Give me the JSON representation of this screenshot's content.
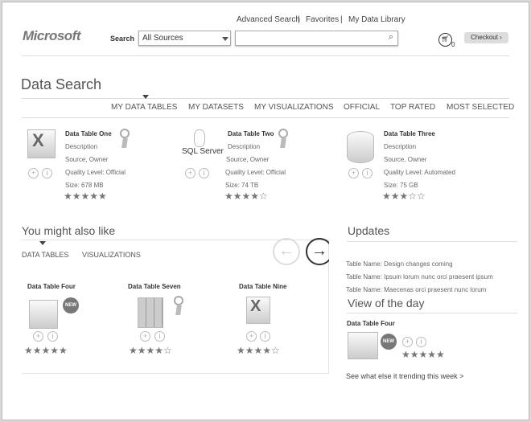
{
  "header": {
    "links": [
      "Advanced Search",
      "Favorites",
      "My Data Library"
    ],
    "separator": "|",
    "logo": "Microsoft",
    "search_label": "Search",
    "source_select": "All Sources",
    "search_value": "",
    "cart_count": "0",
    "checkout": "Checkout ›"
  },
  "main": {
    "title": "Data Search",
    "tabs": [
      "MY DATA TABLES",
      "MY DATASETS",
      "MY VISUALIZATIONS",
      "OFFICIAL",
      "TOP RATED",
      "MOST SELECTED"
    ],
    "active_tab": 0,
    "cards": [
      {
        "title": "Data Table One",
        "description": "Description",
        "source": "Source, Owner",
        "quality": "Quality Level: Official",
        "size": "Size: 678 MB",
        "stars": "★★★★★",
        "rating": 5,
        "icon": "excel-icon",
        "award": true
      },
      {
        "title": "Data Table Two",
        "description": "Description",
        "source": "Source, Owner",
        "quality": "Quality Level: Official",
        "size": "Size: 74 TB",
        "stars": "★★★★☆",
        "rating": 4,
        "icon": "sql-server-icon",
        "icon_text": "SQL Server",
        "award": true
      },
      {
        "title": "Data Table Three",
        "description": "Description",
        "source": "Source, Owner",
        "quality": "Quality Level: Automated",
        "size": "Size: 75 GB",
        "stars": "★★★☆☆",
        "rating": 3,
        "icon": "database-icon",
        "award": false
      }
    ]
  },
  "suggest": {
    "title": "You might also like",
    "tabs": [
      "DATA TABLES",
      "VISUALIZATIONS"
    ],
    "items": [
      {
        "title": "Data Table Four",
        "stars": "★★★★★",
        "rating": 5,
        "badge": "NEW"
      },
      {
        "title": "Data Table Seven",
        "stars": "★★★★☆",
        "rating": 4
      },
      {
        "title": "Data Table Nine",
        "stars": "★★★★☆",
        "rating": 4
      }
    ]
  },
  "updates": {
    "title": "Updates",
    "items": [
      "Table Name: Design changes coming",
      "Table Name: Ipsum lorum nunc orci praesent ipsum",
      "Table Name: Maecenas orci praesent nunc lorum"
    ]
  },
  "view_of_day": {
    "title": "View of the day",
    "item_title": "Data Table Four",
    "badge": "NEW",
    "stars": "★★★★★",
    "rating": 5,
    "link": "See what else it trending this week  >"
  }
}
